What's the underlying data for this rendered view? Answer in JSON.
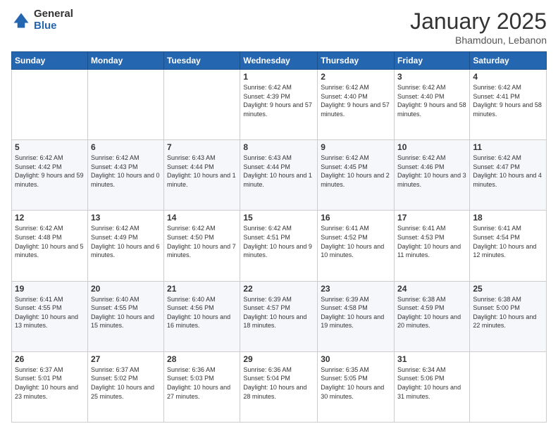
{
  "header": {
    "logo_general": "General",
    "logo_blue": "Blue",
    "month_title": "January 2025",
    "location": "Bhamdoun, Lebanon"
  },
  "weekdays": [
    "Sunday",
    "Monday",
    "Tuesday",
    "Wednesday",
    "Thursday",
    "Friday",
    "Saturday"
  ],
  "weeks": [
    [
      {
        "day": "",
        "info": ""
      },
      {
        "day": "",
        "info": ""
      },
      {
        "day": "",
        "info": ""
      },
      {
        "day": "1",
        "info": "Sunrise: 6:42 AM\nSunset: 4:39 PM\nDaylight: 9 hours and 57 minutes."
      },
      {
        "day": "2",
        "info": "Sunrise: 6:42 AM\nSunset: 4:40 PM\nDaylight: 9 hours and 57 minutes."
      },
      {
        "day": "3",
        "info": "Sunrise: 6:42 AM\nSunset: 4:40 PM\nDaylight: 9 hours and 58 minutes."
      },
      {
        "day": "4",
        "info": "Sunrise: 6:42 AM\nSunset: 4:41 PM\nDaylight: 9 hours and 58 minutes."
      }
    ],
    [
      {
        "day": "5",
        "info": "Sunrise: 6:42 AM\nSunset: 4:42 PM\nDaylight: 9 hours and 59 minutes."
      },
      {
        "day": "6",
        "info": "Sunrise: 6:42 AM\nSunset: 4:43 PM\nDaylight: 10 hours and 0 minutes."
      },
      {
        "day": "7",
        "info": "Sunrise: 6:43 AM\nSunset: 4:44 PM\nDaylight: 10 hours and 1 minute."
      },
      {
        "day": "8",
        "info": "Sunrise: 6:43 AM\nSunset: 4:44 PM\nDaylight: 10 hours and 1 minute."
      },
      {
        "day": "9",
        "info": "Sunrise: 6:42 AM\nSunset: 4:45 PM\nDaylight: 10 hours and 2 minutes."
      },
      {
        "day": "10",
        "info": "Sunrise: 6:42 AM\nSunset: 4:46 PM\nDaylight: 10 hours and 3 minutes."
      },
      {
        "day": "11",
        "info": "Sunrise: 6:42 AM\nSunset: 4:47 PM\nDaylight: 10 hours and 4 minutes."
      }
    ],
    [
      {
        "day": "12",
        "info": "Sunrise: 6:42 AM\nSunset: 4:48 PM\nDaylight: 10 hours and 5 minutes."
      },
      {
        "day": "13",
        "info": "Sunrise: 6:42 AM\nSunset: 4:49 PM\nDaylight: 10 hours and 6 minutes."
      },
      {
        "day": "14",
        "info": "Sunrise: 6:42 AM\nSunset: 4:50 PM\nDaylight: 10 hours and 7 minutes."
      },
      {
        "day": "15",
        "info": "Sunrise: 6:42 AM\nSunset: 4:51 PM\nDaylight: 10 hours and 9 minutes."
      },
      {
        "day": "16",
        "info": "Sunrise: 6:41 AM\nSunset: 4:52 PM\nDaylight: 10 hours and 10 minutes."
      },
      {
        "day": "17",
        "info": "Sunrise: 6:41 AM\nSunset: 4:53 PM\nDaylight: 10 hours and 11 minutes."
      },
      {
        "day": "18",
        "info": "Sunrise: 6:41 AM\nSunset: 4:54 PM\nDaylight: 10 hours and 12 minutes."
      }
    ],
    [
      {
        "day": "19",
        "info": "Sunrise: 6:41 AM\nSunset: 4:55 PM\nDaylight: 10 hours and 13 minutes."
      },
      {
        "day": "20",
        "info": "Sunrise: 6:40 AM\nSunset: 4:55 PM\nDaylight: 10 hours and 15 minutes."
      },
      {
        "day": "21",
        "info": "Sunrise: 6:40 AM\nSunset: 4:56 PM\nDaylight: 10 hours and 16 minutes."
      },
      {
        "day": "22",
        "info": "Sunrise: 6:39 AM\nSunset: 4:57 PM\nDaylight: 10 hours and 18 minutes."
      },
      {
        "day": "23",
        "info": "Sunrise: 6:39 AM\nSunset: 4:58 PM\nDaylight: 10 hours and 19 minutes."
      },
      {
        "day": "24",
        "info": "Sunrise: 6:38 AM\nSunset: 4:59 PM\nDaylight: 10 hours and 20 minutes."
      },
      {
        "day": "25",
        "info": "Sunrise: 6:38 AM\nSunset: 5:00 PM\nDaylight: 10 hours and 22 minutes."
      }
    ],
    [
      {
        "day": "26",
        "info": "Sunrise: 6:37 AM\nSunset: 5:01 PM\nDaylight: 10 hours and 23 minutes."
      },
      {
        "day": "27",
        "info": "Sunrise: 6:37 AM\nSunset: 5:02 PM\nDaylight: 10 hours and 25 minutes."
      },
      {
        "day": "28",
        "info": "Sunrise: 6:36 AM\nSunset: 5:03 PM\nDaylight: 10 hours and 27 minutes."
      },
      {
        "day": "29",
        "info": "Sunrise: 6:36 AM\nSunset: 5:04 PM\nDaylight: 10 hours and 28 minutes."
      },
      {
        "day": "30",
        "info": "Sunrise: 6:35 AM\nSunset: 5:05 PM\nDaylight: 10 hours and 30 minutes."
      },
      {
        "day": "31",
        "info": "Sunrise: 6:34 AM\nSunset: 5:06 PM\nDaylight: 10 hours and 31 minutes."
      },
      {
        "day": "",
        "info": ""
      }
    ]
  ]
}
